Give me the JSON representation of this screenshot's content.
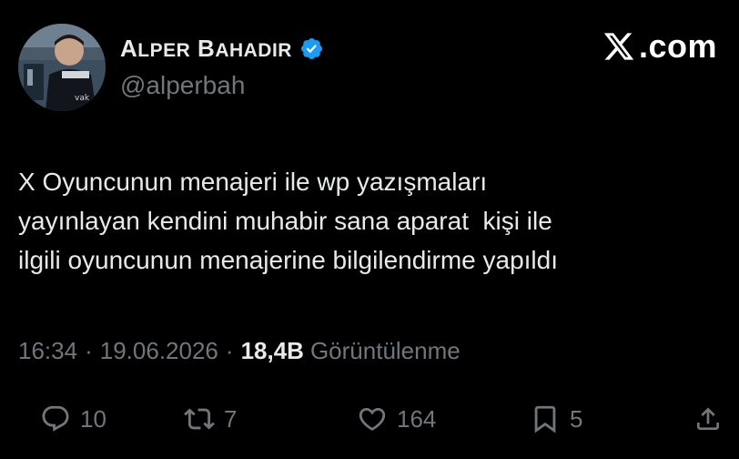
{
  "author": {
    "display_name_first_initial": "A",
    "display_name_first_rest": "LPER",
    "display_name_last_initial": "B",
    "display_name_last_rest": "AHADIR",
    "handle": "@alperbah",
    "verified": true,
    "verified_color": "#1d9bf0"
  },
  "source": {
    "brand_text": ".com"
  },
  "tweet": {
    "lines": [
      "X Oyuncunun menajeri ile wp yazışmaları",
      "yayınlayan kendini muhabir sana aparat  kişi ile",
      "ilgili oyuncunun menajerine bilgilendirme yapıldı"
    ]
  },
  "meta": {
    "time": "16:34",
    "date": "19.06.2026",
    "separator": "·",
    "views_count": "18,4B",
    "views_label": "Görüntülenme"
  },
  "actions": {
    "replies": "10",
    "reposts": "7",
    "likes": "164",
    "bookmarks": "5"
  },
  "icons": {
    "reply": "reply-icon",
    "repost": "repost-icon",
    "like": "heart-icon",
    "bookmark": "bookmark-icon",
    "share": "share-icon",
    "brand": "x-logo-icon",
    "verified": "verified-badge-icon"
  },
  "colors": {
    "background": "#000000",
    "primary_text": "#e7e9ea",
    "secondary_text": "#71767b",
    "accent": "#1d9bf0"
  }
}
